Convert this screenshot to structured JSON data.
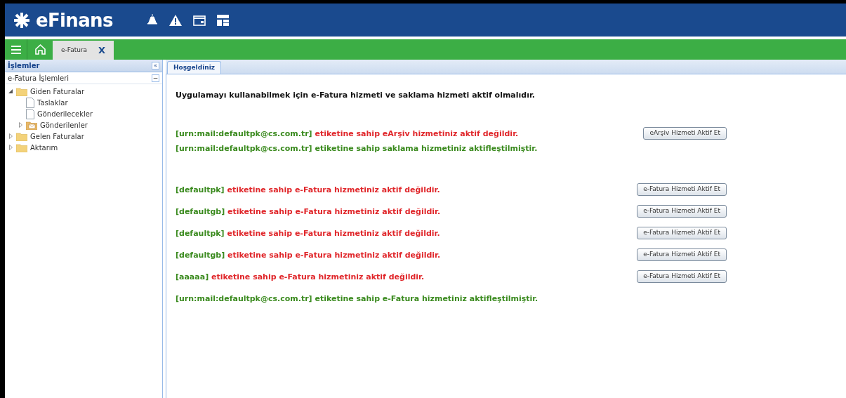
{
  "header": {
    "logo": "eFinans"
  },
  "nav": {
    "tab": {
      "label": "e-Fatura",
      "close": "X"
    }
  },
  "sidebar": {
    "title": "İşlemler",
    "collapse": "«",
    "section": {
      "title": "e-Fatura İşlemleri",
      "toggle": "−"
    },
    "tree": [
      {
        "label": "Giden Faturalar",
        "kind": "folder",
        "expanded": true,
        "children": [
          {
            "label": "Taslaklar",
            "kind": "document"
          },
          {
            "label": "Gönderilecekler",
            "kind": "document"
          },
          {
            "label": "Gönderilenler",
            "kind": "mail",
            "expanded": false
          }
        ]
      },
      {
        "label": "Gelen Faturalar",
        "kind": "folder",
        "expanded": false
      },
      {
        "label": "Aktarım",
        "kind": "folder",
        "expanded": false
      }
    ]
  },
  "main": {
    "tab": {
      "label": "Hoşgeldiniz",
      "selected": true
    },
    "notice": "Uygulamayı kullanabilmek için e-Fatura hizmeti ve saklama hizmeti aktif olmalıdır.",
    "groups": [
      {
        "messages": [
          {
            "tag": "[urn:mail:defaultpk@cs.com.tr]",
            "text": "etiketine sahip eArşiv hizmetiniz aktif değildir.",
            "active": false,
            "button": "eArşiv Hizmeti Aktif Et"
          },
          {
            "tag": "[urn:mail:defaultpk@cs.com.tr]",
            "text": "etiketine sahip saklama hizmetiniz aktifleştilmiştir.",
            "active": true
          }
        ]
      },
      {
        "messages": [
          {
            "tag": "[defaultpk]",
            "text": "etiketine sahip e-Fatura hizmetiniz aktif değildir.",
            "active": false,
            "button": "e-Fatura Hizmeti Aktif Et"
          },
          {
            "tag": "[defaultgb]",
            "text": "etiketine sahip e-Fatura hizmetiniz aktif değildir.",
            "active": false,
            "button": "e-Fatura Hizmeti Aktif Et"
          },
          {
            "tag": "[defaultpk]",
            "text": "etiketine sahip e-Fatura hizmetiniz aktif değildir.",
            "active": false,
            "button": "e-Fatura Hizmeti Aktif Et"
          },
          {
            "tag": "[defaultgb]",
            "text": "etiketine sahip e-Fatura hizmetiniz aktif değildir.",
            "active": false,
            "button": "e-Fatura Hizmeti Aktif Et"
          },
          {
            "tag": "[aaaaa]",
            "text": "etiketine sahip e-Fatura hizmetiniz aktif değildir.",
            "active": false,
            "button": "e-Fatura Hizmeti Aktif Et"
          },
          {
            "tag": "[urn:mail:defaultpk@cs.com.tr]",
            "text": "etiketine sahip e-Fatura hizmetiniz aktifleştilmiştir.",
            "active": true
          }
        ]
      }
    ]
  }
}
